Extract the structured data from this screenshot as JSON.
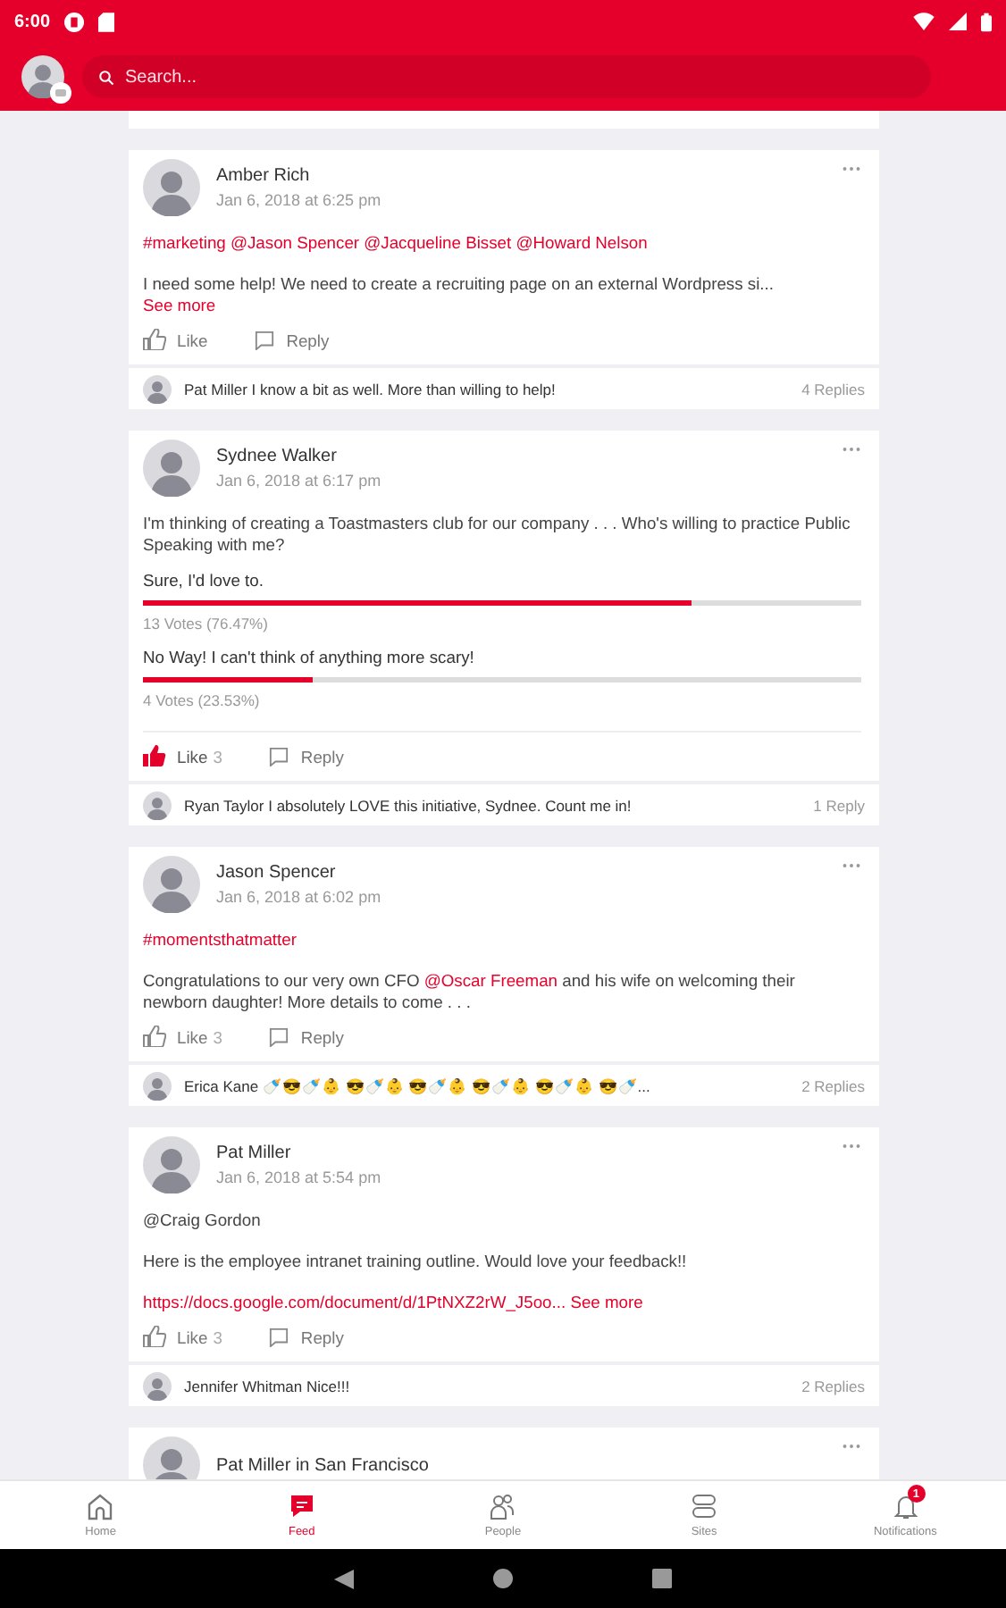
{
  "status_bar": {
    "time": "6:00"
  },
  "header": {
    "search": {
      "placeholder": "Search..."
    }
  },
  "posts": [
    {
      "author": "Amber Rich",
      "time": "Jan 6, 2018 at 6:25 pm",
      "tags": "#marketing @Jason Spencer @Jacqueline Bisset @Howard Nelson",
      "body": [
        {
          "kind": "text",
          "text": "I need some help! We need to create a recruiting page on an external Wordpress si..."
        }
      ],
      "see_more": "See more",
      "actions": {
        "like": "Like",
        "reply": "Reply",
        "liked": false
      },
      "comment": {
        "author": "Pat Miller",
        "text": "I know a bit as well.  More than willing to help!",
        "replies": "4 Replies"
      }
    },
    {
      "author": "Sydnee Walker",
      "time": "Jan 6, 2018 at 6:17 pm",
      "body": [
        {
          "kind": "text",
          "text": "I'm thinking of creating a Toastmasters club for our company . . . Who's willing to practice Public Speaking with me?"
        }
      ],
      "poll": [
        {
          "label": "Sure, I'd love to.",
          "level": 0.7647,
          "votes": "13 Votes (76.47%)"
        },
        {
          "label": "No Way! I can't think of anything more scary!",
          "level": 0.2353,
          "votes": "4 Votes (23.53%)"
        }
      ],
      "actions": {
        "like": "Like",
        "like_count": "3",
        "reply": "Reply",
        "liked": true
      },
      "comment": {
        "author": "Ryan Taylor",
        "text": "I absolutely LOVE this initiative, Sydnee.  Count me in!",
        "replies": "1 Reply"
      }
    },
    {
      "author": "Jason Spencer",
      "time": "Jan 6, 2018 at 6:02 pm",
      "tags": "#momentsthatmatter",
      "body": [
        {
          "kind": "text",
          "text": "Congratulations to our very own CFO "
        },
        {
          "kind": "mention",
          "text": "@Oscar Freeman"
        },
        {
          "kind": "text",
          "text": " and his wife on welcoming their newborn daughter! More details to come . . ."
        }
      ],
      "actions": {
        "like": "Like",
        "like_count": "3",
        "reply": "Reply",
        "liked": false
      },
      "comment": {
        "author": "Erica Kane",
        "text": "🍼😎🍼👶 😎🍼👶 😎🍼👶 😎🍼👶 😎🍼👶 😎🍼...",
        "replies": "2 Replies"
      }
    },
    {
      "author": "Pat Miller",
      "time": "Jan 6, 2018 at 5:54 pm",
      "mention_line": "@Craig Gordon",
      "body": [
        {
          "kind": "text",
          "text": "Here is the employee intranet training outline.  Would love your feedback!!"
        }
      ],
      "link": "https://docs.google.com/document/d/1PtNXZ2rW_J5oo...",
      "see_more": "See more",
      "actions": {
        "like": "Like",
        "like_count": "3",
        "reply": "Reply",
        "liked": false
      },
      "comment": {
        "author": "Jennifer Whitman",
        "text": "Nice!!!",
        "replies": "2 Replies"
      }
    },
    {
      "author": "Pat Miller in San Francisco"
    }
  ],
  "nav": [
    {
      "label": "Home",
      "kind": "home",
      "selected": false
    },
    {
      "label": "Feed",
      "kind": "feed",
      "selected": true
    },
    {
      "label": "People",
      "kind": "people",
      "selected": false
    },
    {
      "label": "Sites",
      "kind": "sites",
      "selected": false
    },
    {
      "label": "Notifications",
      "kind": "bell",
      "selected": false,
      "badge": "1"
    }
  ]
}
